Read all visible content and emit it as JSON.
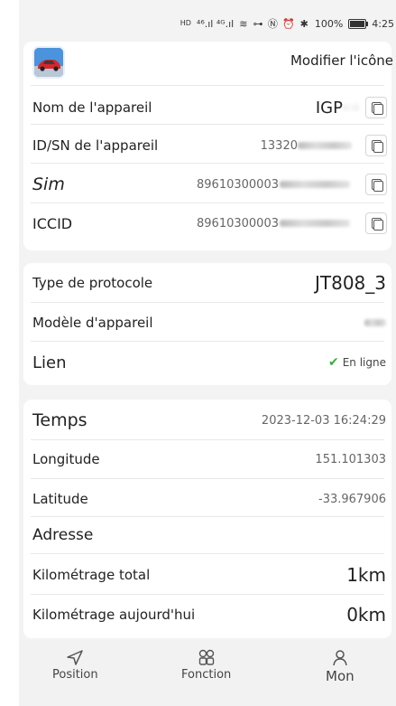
{
  "status_bar": {
    "sim_tags": "HD",
    "signal": "⁴⁶.ıl ⁴ᴳ.ıl",
    "wifi": "≋",
    "icons": "⊶ Ⓝ ⏰ ✱",
    "battery_percent": "100%",
    "battery_level": 1.0,
    "time": "4:25"
  },
  "device_card": {
    "edit_icon_label": "Modifier l'icône",
    "thumbnail_icon": "car-icon",
    "rows": [
      {
        "label": "Nom de l'appareil",
        "value": "IGP",
        "copy_icon": "copy-icon"
      },
      {
        "label": "ID/SN de l'appareil",
        "value": "13320",
        "copy_icon": "copy-icon"
      },
      {
        "label": "Sim",
        "value": "89610300003",
        "copy_icon": "copy-icon"
      },
      {
        "label": "ICCID",
        "value": "89610300003",
        "copy_icon": "copy-icon"
      }
    ]
  },
  "protocol_card": {
    "protocol_label": "Type de protocole",
    "protocol_value": "JT808_3",
    "model_label": "Modèle d'appareil",
    "link_label": "Lien",
    "link_status": "En ligne",
    "link_status_icon": "check-icon"
  },
  "location_card": {
    "time_label": "Temps",
    "time_value": "2023-12-03 16:24:29",
    "longitude_label": "Longitude",
    "longitude_value": "151.101303",
    "latitude_label": "Latitude",
    "latitude_value": "-33.967906",
    "address_label": "Adresse",
    "total_km_label": "Kilométrage total",
    "total_km_value": "1km",
    "today_km_label": "Kilométrage aujourd'hui",
    "today_km_value": "0km"
  },
  "tabbar": {
    "tabs": [
      {
        "label": "Position",
        "icon": "navigation-arrow-icon"
      },
      {
        "label": "Fonction",
        "icon": "grid-apps-icon"
      },
      {
        "label": "Mon",
        "icon": "user-icon"
      }
    ]
  },
  "colors": {
    "background": "#f3f3f3",
    "card": "#ffffff",
    "online_check": "#3aae3a",
    "thumbnail": "#3f8ad6"
  }
}
